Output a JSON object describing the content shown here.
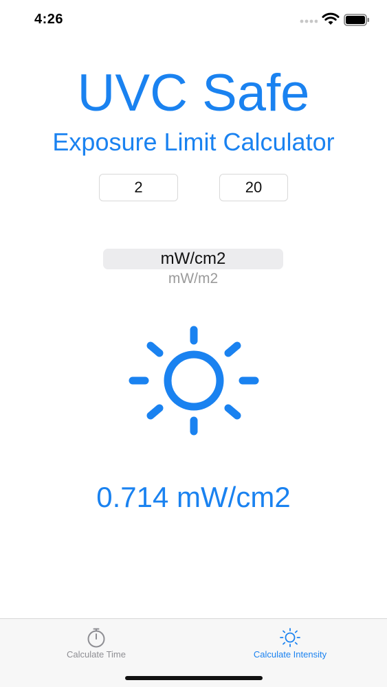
{
  "status_bar": {
    "time": "4:26",
    "signal_icon": "cellular-signal-icon",
    "wifi_icon": "wifi-icon",
    "battery_icon": "battery-icon"
  },
  "header": {
    "title": "UVC Safe",
    "subtitle": "Exposure Limit Calculator"
  },
  "inputs": {
    "first_value": "2",
    "second_value": "20"
  },
  "unit_picker": {
    "selected": "mW/cm2",
    "options": [
      "mW/cm2",
      "mW/m2"
    ],
    "next_option": "mW/m2"
  },
  "main": {
    "icon": "sun-icon",
    "result": "0.714 mW/cm2"
  },
  "tab_bar": {
    "tabs": [
      {
        "label": "Calculate Time",
        "icon": "stopwatch-icon",
        "active": false
      },
      {
        "label": "Calculate Intensity",
        "icon": "sun-icon",
        "active": true
      }
    ]
  },
  "colors": {
    "accent": "#1a82f0",
    "inactive_tab": "#8e8e93",
    "background": "#ffffff"
  }
}
